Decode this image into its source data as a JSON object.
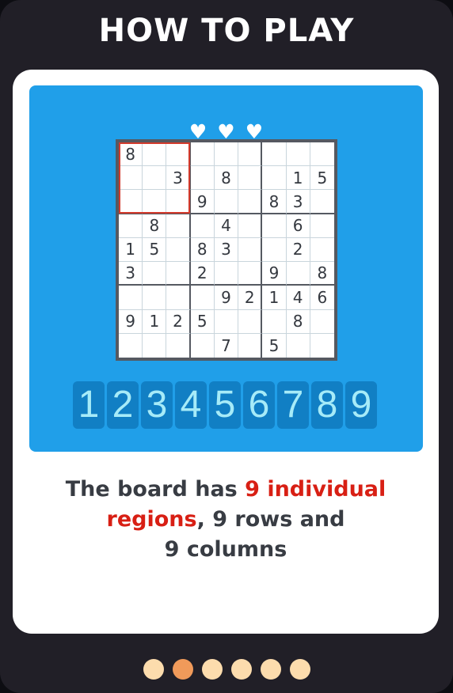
{
  "title": "HOW TO PLAY",
  "hearts": {
    "count": 3,
    "glyph": "♥"
  },
  "board": {
    "grid": [
      [
        "8",
        "",
        "",
        "",
        "",
        "",
        "",
        "",
        ""
      ],
      [
        "",
        "",
        "3",
        "",
        "8",
        "",
        "",
        "1",
        "5"
      ],
      [
        "",
        "",
        "",
        "9",
        "",
        "",
        "8",
        "3",
        ""
      ],
      [
        "",
        "8",
        "",
        "",
        "4",
        "",
        "",
        "6",
        ""
      ],
      [
        "1",
        "5",
        "",
        "8",
        "3",
        "",
        "",
        "2",
        ""
      ],
      [
        "3",
        "",
        "",
        "2",
        "",
        "",
        "9",
        "",
        "8"
      ],
      [
        "",
        "",
        "",
        "",
        "9",
        "2",
        "1",
        "4",
        "6"
      ],
      [
        "9",
        "1",
        "2",
        "5",
        "",
        "",
        "",
        "8",
        ""
      ],
      [
        "",
        "",
        "",
        "",
        "7",
        "",
        "5",
        "",
        ""
      ]
    ],
    "highlighted_region": "top-left"
  },
  "numpad": [
    "1",
    "2",
    "3",
    "4",
    "5",
    "6",
    "7",
    "8",
    "9"
  ],
  "description": {
    "part1": "The board has ",
    "highlight1": "9 individual",
    "highlight2": "regions",
    "part2": ", 9 rows and",
    "part3": "9 columns"
  },
  "pagination": {
    "total": 6,
    "active_index": 1
  },
  "colors": {
    "frame": "#211f27",
    "panel": "#209fe9",
    "key": "#117fc4",
    "key_text": "#a6ebf8",
    "highlight_text": "#d81f14",
    "region_outline": "#d33a2c",
    "dot": "#fcdcad",
    "dot_active": "#f09a5a"
  }
}
